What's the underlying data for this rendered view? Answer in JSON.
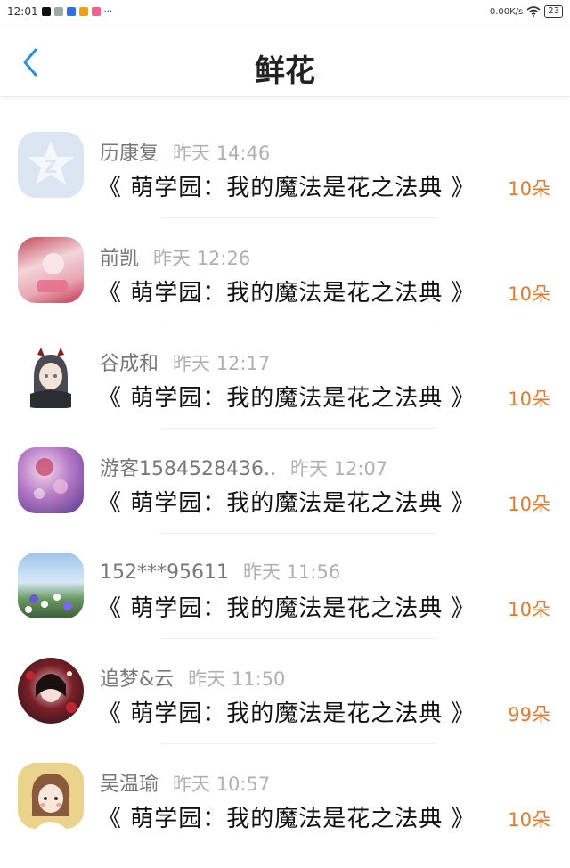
{
  "status_bar": {
    "time": "12:01",
    "dots": "···",
    "network_speed": "0.00K/s",
    "battery": "23"
  },
  "header": {
    "title": "鲜花"
  },
  "book_title": "《 萌学园：我的魔法是花之法典 》",
  "colors": {
    "accent_blue": "#2b8fe0",
    "amount_orange": "#e07b32"
  },
  "entries": [
    {
      "name": "历康复",
      "time": "昨天 14:46",
      "book": "《 萌学园：我的魔法是花之法典 》",
      "amount": "10朵",
      "avatar": "default-z-logo"
    },
    {
      "name": "前凯",
      "time": "昨天 12:26",
      "book": "《 萌学园：我的魔法是花之法典 》",
      "amount": "10朵",
      "avatar": "pink-bottle"
    },
    {
      "name": "谷成和",
      "time": "昨天 12:17",
      "book": "《 萌学园：我的魔法是花之法典 》",
      "amount": "10朵",
      "avatar": "anime-girl-horns"
    },
    {
      "name": "游客1584528436..",
      "time": "昨天 12:07",
      "book": "《 萌学园：我的魔法是花之法典 》",
      "amount": "10朵",
      "avatar": "purple-bubbles"
    },
    {
      "name": "152***95611",
      "time": "昨天 11:56",
      "book": "《 萌学园：我的魔法是花之法典 》",
      "amount": "10朵",
      "avatar": "flower-sky"
    },
    {
      "name": "追梦&云",
      "time": "昨天 11:50",
      "book": "《 萌学园：我的魔法是花之法典 》",
      "amount": "99朵",
      "avatar": "dark-anime-girl"
    },
    {
      "name": "吴温瑜",
      "time": "昨天 10:57",
      "book": "《 萌学园：我的魔法是花之法典 》",
      "amount": "10朵",
      "avatar": "cartoon-girl"
    }
  ]
}
